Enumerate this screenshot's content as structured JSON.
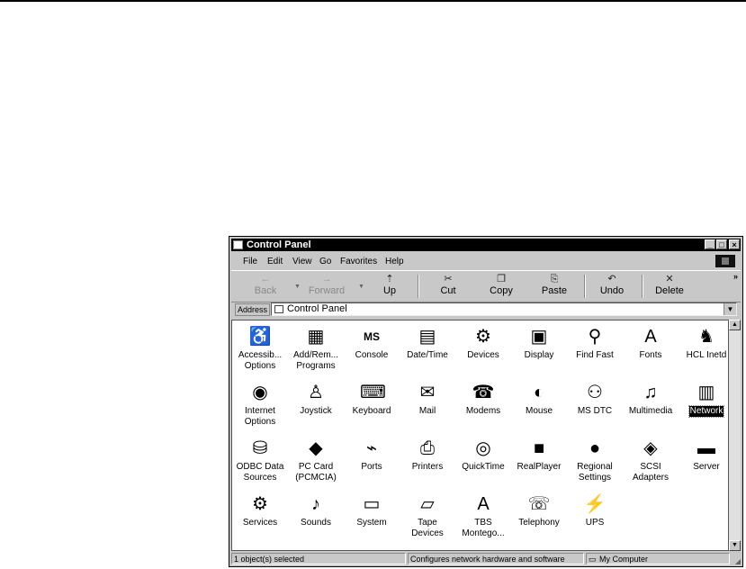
{
  "window": {
    "title": "Control Panel"
  },
  "menu": [
    "File",
    "Edit",
    "View",
    "Go",
    "Favorites",
    "Help"
  ],
  "toolbar": {
    "back": "Back",
    "forward": "Forward",
    "up": "Up",
    "cut": "Cut",
    "copy": "Copy",
    "paste": "Paste",
    "undo": "Undo",
    "delete": "Delete"
  },
  "address": {
    "label": "Address",
    "value": "Control Panel"
  },
  "items": [
    {
      "label1": "Accessib...",
      "label2": "Options",
      "icon": "accessibility-icon",
      "glyph": "♿"
    },
    {
      "label1": "Add/Rem...",
      "label2": "Programs",
      "icon": "add-remove-programs-icon",
      "glyph": "▦"
    },
    {
      "label1": "Console",
      "label2": "",
      "icon": "ms-dos-console-icon",
      "glyph": "MS"
    },
    {
      "label1": "Date/Time",
      "label2": "",
      "icon": "calendar-clock-icon",
      "glyph": "▤"
    },
    {
      "label1": "Devices",
      "label2": "",
      "icon": "devices-icon",
      "glyph": "⚙"
    },
    {
      "label1": "Display",
      "label2": "",
      "icon": "display-icon",
      "glyph": "▣"
    },
    {
      "label1": "Find Fast",
      "label2": "",
      "icon": "binoculars-icon",
      "glyph": "⚲"
    },
    {
      "label1": "Fonts",
      "label2": "",
      "icon": "fonts-folder-icon",
      "glyph": "A"
    },
    {
      "label1": "HCL Inetd",
      "label2": "",
      "icon": "hcl-inetd-icon",
      "glyph": "♞"
    },
    {
      "label1": "Internet",
      "label2": "Options",
      "icon": "internet-options-icon",
      "glyph": "◉"
    },
    {
      "label1": "Joystick",
      "label2": "",
      "icon": "joystick-icon",
      "glyph": "♙"
    },
    {
      "label1": "Keyboard",
      "label2": "",
      "icon": "keyboard-icon",
      "glyph": "⌨"
    },
    {
      "label1": "Mail",
      "label2": "",
      "icon": "mail-icon",
      "glyph": "✉"
    },
    {
      "label1": "Modems",
      "label2": "",
      "icon": "modem-phone-icon",
      "glyph": "☎"
    },
    {
      "label1": "Mouse",
      "label2": "",
      "icon": "mouse-icon",
      "glyph": "◐"
    },
    {
      "label1": "MS DTC",
      "label2": "",
      "icon": "ms-dtc-icon",
      "glyph": "⚇"
    },
    {
      "label1": "Multimedia",
      "label2": "",
      "icon": "multimedia-icon",
      "glyph": "♫"
    },
    {
      "label1": "Network",
      "label2": "",
      "icon": "network-icon",
      "glyph": "▥"
    },
    {
      "label1": "ODBC Data",
      "label2": "Sources",
      "icon": "odbc-icon",
      "glyph": "⛁"
    },
    {
      "label1": "PC Card",
      "label2": "(PCMCIA)",
      "icon": "pc-card-icon",
      "glyph": "◆"
    },
    {
      "label1": "Ports",
      "label2": "",
      "icon": "ports-icon",
      "glyph": "⌁"
    },
    {
      "label1": "Printers",
      "label2": "",
      "icon": "printers-folder-icon",
      "glyph": "⎙"
    },
    {
      "label1": "QuickTime",
      "label2": "",
      "icon": "quicktime-icon",
      "glyph": "◎"
    },
    {
      "label1": "RealPlayer",
      "label2": "",
      "icon": "realplayer-icon",
      "glyph": "■"
    },
    {
      "label1": "Regional",
      "label2": "Settings",
      "icon": "globe-icon",
      "glyph": "●"
    },
    {
      "label1": "SCSI",
      "label2": "Adapters",
      "icon": "scsi-icon",
      "glyph": "◈"
    },
    {
      "label1": "Server",
      "label2": "",
      "icon": "server-icon",
      "glyph": "▬"
    },
    {
      "label1": "Services",
      "label2": "",
      "icon": "services-gears-icon",
      "glyph": "⚙"
    },
    {
      "label1": "Sounds",
      "label2": "",
      "icon": "sounds-icon",
      "glyph": "♪"
    },
    {
      "label1": "System",
      "label2": "",
      "icon": "system-computer-icon",
      "glyph": "▭"
    },
    {
      "label1": "Tape",
      "label2": "Devices",
      "icon": "tape-devices-icon",
      "glyph": "▱"
    },
    {
      "label1": "TBS",
      "label2": "Montego...",
      "icon": "tbs-montego-icon",
      "glyph": "A"
    },
    {
      "label1": "Telephony",
      "label2": "",
      "icon": "telephony-icon",
      "glyph": "☏"
    },
    {
      "label1": "UPS",
      "label2": "",
      "icon": "ups-icon",
      "glyph": "⚡"
    }
  ],
  "selected_item": "Network",
  "status": {
    "selection": "1 object(s) selected",
    "description": "Configures network hardware and software",
    "location": "My Computer"
  }
}
